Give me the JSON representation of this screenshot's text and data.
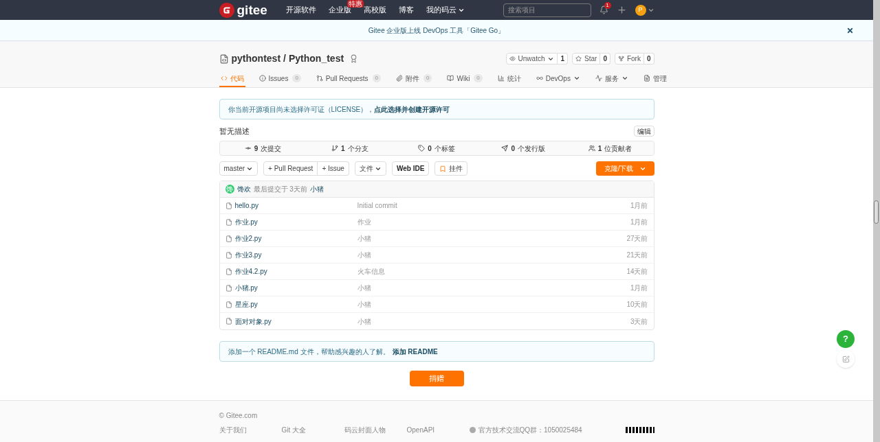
{
  "navbar": {
    "logo": "gitee",
    "links": [
      {
        "label": "开源软件",
        "dropdown": false
      },
      {
        "label": "企业版",
        "badge": "特惠",
        "dropdown": false
      },
      {
        "label": "高校版",
        "dropdown": false
      },
      {
        "label": "博客",
        "dropdown": false
      },
      {
        "label": "我的码云",
        "dropdown": true
      }
    ],
    "search": {
      "placeholder": "搜索项目"
    },
    "notifications": "1",
    "avatar": "P"
  },
  "banner": {
    "text": "Gitee 企业版上线 DevOps 工具「Gitee Go」"
  },
  "repo": {
    "owner": "pythontest",
    "separator": "/",
    "name": "Python_test",
    "actions": [
      {
        "label": "Unwatch",
        "count": "1",
        "dropdown": true
      },
      {
        "label": "Star",
        "count": "0",
        "dropdown": false
      },
      {
        "label": "Fork",
        "count": "0",
        "dropdown": false
      }
    ],
    "tabs": [
      {
        "label": "代码",
        "dropdown": false,
        "selected": true
      },
      {
        "label": "Issues",
        "count": "0",
        "dropdown": false,
        "selected": false
      },
      {
        "label": "Pull Requests",
        "count": "0",
        "dropdown": false,
        "selected": false
      },
      {
        "label": "附件",
        "count": "0",
        "dropdown": false,
        "selected": false
      },
      {
        "label": "Wiki",
        "count": "0",
        "dropdown": false,
        "selected": false
      },
      {
        "label": "统计",
        "dropdown": false,
        "selected": false
      },
      {
        "label": "DevOps",
        "dropdown": true,
        "selected": false
      },
      {
        "label": "服务",
        "dropdown": true,
        "selected": false
      },
      {
        "label": "管理",
        "dropdown": false,
        "selected": false
      }
    ]
  },
  "license_notice": {
    "text": "你当前开源项目尚未选择许可证（LICENSE），",
    "link": "点此选择并创建开源许可"
  },
  "description": {
    "text": "暂无描述",
    "edit": "编辑"
  },
  "stats": [
    {
      "count": "9",
      "label": "次提交"
    },
    {
      "count": "1",
      "label": "个分支"
    },
    {
      "count": "0",
      "label": "个标签"
    },
    {
      "count": "0",
      "label": "个发行版"
    },
    {
      "count": "1",
      "label": "位贡献者"
    }
  ],
  "toolbar": {
    "branch": "master",
    "pull_request": "+ Pull Request",
    "issue": "+ Issue",
    "file": "文件",
    "web_ide": "Web IDE",
    "widget": "挂件",
    "clone": "克隆/下载"
  },
  "last_commit": {
    "avatar": "馋",
    "author": "馋欢",
    "text": "最后提交于 3天前",
    "message": "小猪"
  },
  "files": [
    {
      "name": "hello.py",
      "message": "Initial commit",
      "time": "1月前"
    },
    {
      "name": "作业.py",
      "message": "作业",
      "time": "1月前"
    },
    {
      "name": "作业2.py",
      "message": "小猪",
      "time": "27天前"
    },
    {
      "name": "作业3.py",
      "message": "小猪",
      "time": "21天前"
    },
    {
      "name": "作业4.2.py",
      "message": "火车信息",
      "time": "14天前"
    },
    {
      "name": "小猪.py",
      "message": "小猪",
      "time": "1月前"
    },
    {
      "name": "星座.py",
      "message": "小猪",
      "time": "10天前"
    },
    {
      "name": "面对对象.py",
      "message": "小猪",
      "time": "3天前"
    }
  ],
  "readme_notice": {
    "text": "添加一个 README.md 文件，帮助感兴趣的人了解。",
    "link": "添加 README"
  },
  "donate": "捐赠",
  "footer": {
    "copyright": "© Gitee.com",
    "links": [
      "关于我们",
      "Git 大全",
      "码云封面人物",
      "OpenAPI"
    ],
    "qq": "官方技术交流QQ群：1050025484"
  },
  "floating": {
    "help": "?"
  }
}
